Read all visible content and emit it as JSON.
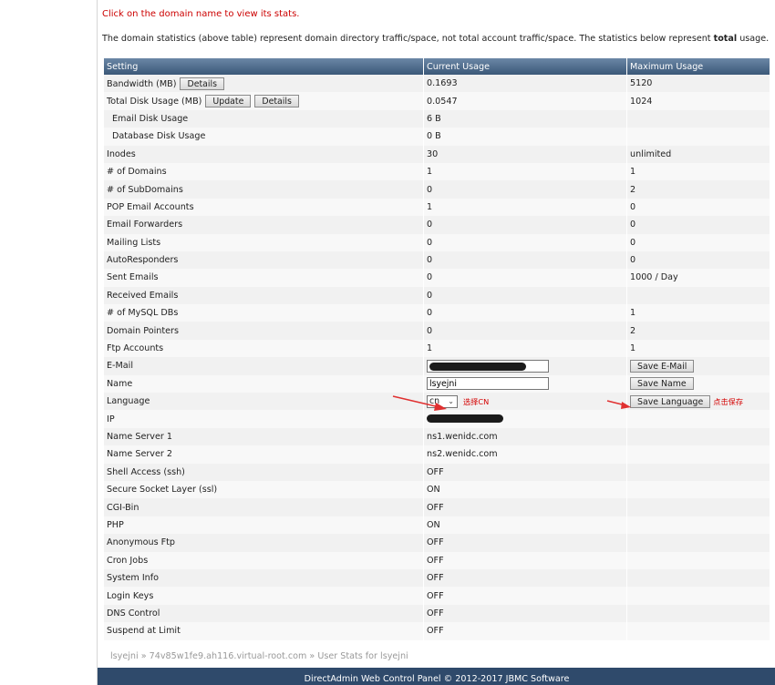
{
  "notice": "Click on the domain name to view its stats.",
  "description": {
    "before": "The domain statistics (above table) represent domain directory traffic/space, not total account traffic/space. The statistics below represent ",
    "bold": "total",
    "after": " usage."
  },
  "table": {
    "headers": [
      "Setting",
      "Current Usage",
      "Maximum Usage"
    ],
    "rows": {
      "bandwidth": {
        "label": "Bandwidth (MB)",
        "details": "Details",
        "current": "0.1693",
        "max": "5120"
      },
      "disk": {
        "label": "Total Disk Usage (MB)",
        "update": "Update",
        "details": "Details",
        "current": "0.0547",
        "max": "1024"
      },
      "email_disk": {
        "label": "Email Disk Usage",
        "current": "6 B",
        "max": ""
      },
      "db_disk": {
        "label": "Database Disk Usage",
        "current": "0 B",
        "max": ""
      },
      "inodes": {
        "label": "Inodes",
        "current": "30",
        "max": "unlimited"
      },
      "domains": {
        "label": "# of Domains",
        "current": "1",
        "max": "1"
      },
      "subdomains": {
        "label": "# of SubDomains",
        "current": "0",
        "max": "2"
      },
      "pop": {
        "label": "POP Email Accounts",
        "current": "1",
        "max": "0"
      },
      "forwarders": {
        "label": "Email Forwarders",
        "current": "0",
        "max": "0"
      },
      "mailing": {
        "label": "Mailing Lists",
        "current": "0",
        "max": "0"
      },
      "autoresponders": {
        "label": "AutoResponders",
        "current": "0",
        "max": "0"
      },
      "sent": {
        "label": "Sent Emails",
        "current": "0",
        "max": "1000 / Day"
      },
      "received": {
        "label": "Received Emails",
        "current": "0",
        "max": ""
      },
      "mysql": {
        "label": "# of MySQL DBs",
        "current": "0",
        "max": "1"
      },
      "pointers": {
        "label": "Domain Pointers",
        "current": "0",
        "max": "2"
      },
      "ftp": {
        "label": "Ftp Accounts",
        "current": "1",
        "max": "1"
      },
      "email": {
        "label": "E-Mail",
        "button": "Save E-Mail"
      },
      "name": {
        "label": "Name",
        "value": "lsyejni",
        "button": "Save Name"
      },
      "language": {
        "label": "Language",
        "selected": "cn",
        "note": "选择CN",
        "button": "Save Language",
        "button_note": "点击保存"
      },
      "ip": {
        "label": "IP"
      },
      "ns1": {
        "label": "Name Server 1",
        "current": "ns1.wenidc.com"
      },
      "ns2": {
        "label": "Name Server 2",
        "current": "ns2.wenidc.com"
      },
      "ssh": {
        "label": "Shell Access (ssh)",
        "current": "OFF"
      },
      "ssl": {
        "label": "Secure Socket Layer (ssl)",
        "current": "ON"
      },
      "cgi": {
        "label": "CGI-Bin",
        "current": "OFF"
      },
      "php": {
        "label": "PHP",
        "current": "ON"
      },
      "anonftp": {
        "label": "Anonymous Ftp",
        "current": "OFF"
      },
      "cron": {
        "label": "Cron Jobs",
        "current": "OFF"
      },
      "sysinfo": {
        "label": "System Info",
        "current": "OFF"
      },
      "loginkeys": {
        "label": "Login Keys",
        "current": "OFF"
      },
      "dns": {
        "label": "DNS Control",
        "current": "OFF"
      },
      "suspend": {
        "label": "Suspend at Limit",
        "current": "OFF"
      }
    }
  },
  "breadcrumb": {
    "user": "lsyejni",
    "sep": " » ",
    "server": "74v85w1fe9.ah116.virtual-root.com",
    "page": "User Stats for lsyejni"
  },
  "footer": "DirectAdmin Web Control Panel © 2012-2017 JBMC Software",
  "colors": {
    "arrow_red": "#e03030",
    "header_blue": "#3b5878",
    "footer_blue": "#2f4a6b"
  }
}
